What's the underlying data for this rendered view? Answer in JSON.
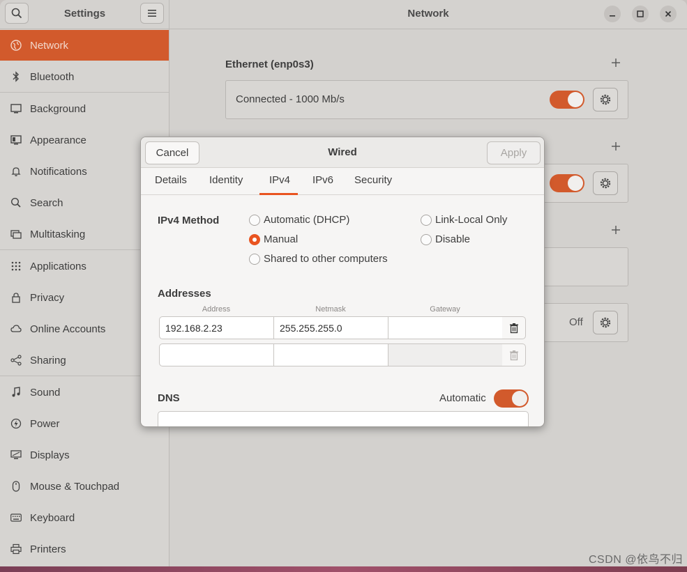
{
  "header": {
    "sidebar_title": "Settings",
    "main_title": "Network"
  },
  "sidebar": {
    "items": [
      {
        "label": "Network",
        "icon": "network-icon",
        "active": true
      },
      {
        "label": "Bluetooth",
        "icon": "bluetooth-icon"
      },
      {
        "label": "Background",
        "icon": "background-icon"
      },
      {
        "label": "Appearance",
        "icon": "appearance-icon"
      },
      {
        "label": "Notifications",
        "icon": "bell-icon"
      },
      {
        "label": "Search",
        "icon": "search-icon"
      },
      {
        "label": "Multitasking",
        "icon": "multitasking-icon"
      },
      {
        "label": "Applications",
        "icon": "apps-grid-icon"
      },
      {
        "label": "Privacy",
        "icon": "lock-icon"
      },
      {
        "label": "Online Accounts",
        "icon": "cloud-icon"
      },
      {
        "label": "Sharing",
        "icon": "share-icon"
      },
      {
        "label": "Sound",
        "icon": "music-note-icon"
      },
      {
        "label": "Power",
        "icon": "power-icon"
      },
      {
        "label": "Displays",
        "icon": "display-icon"
      },
      {
        "label": "Mouse & Touchpad",
        "icon": "mouse-icon"
      },
      {
        "label": "Keyboard",
        "icon": "keyboard-icon"
      },
      {
        "label": "Printers",
        "icon": "printer-icon"
      }
    ]
  },
  "network": {
    "ethernet_title": "Ethernet (enp0s3)",
    "ethernet_status": "Connected - 1000 Mb/s",
    "off_label": "Off"
  },
  "dialog": {
    "cancel_label": "Cancel",
    "title": "Wired",
    "apply_label": "Apply",
    "tabs": [
      "Details",
      "Identity",
      "IPv4",
      "IPv6",
      "Security"
    ],
    "active_tab": "IPv4",
    "ipv4_method_label": "IPv4 Method",
    "methods": {
      "dhcp": "Automatic (DHCP)",
      "manual": "Manual",
      "shared": "Shared to other computers",
      "link_local": "Link-Local Only",
      "disable": "Disable"
    },
    "selected_method": "Manual",
    "addresses_label": "Addresses",
    "columns": {
      "address": "Address",
      "netmask": "Netmask",
      "gateway": "Gateway"
    },
    "rows": [
      {
        "address": "192.168.2.23",
        "netmask": "255.255.255.0",
        "gateway": ""
      },
      {
        "address": "",
        "netmask": "",
        "gateway": ""
      }
    ],
    "dns_label": "DNS",
    "dns_automatic_label": "Automatic"
  },
  "watermark": "CSDN @依鸟不归",
  "colors": {
    "accent": "#e95420",
    "sidebar_active": "#d25a2c"
  }
}
